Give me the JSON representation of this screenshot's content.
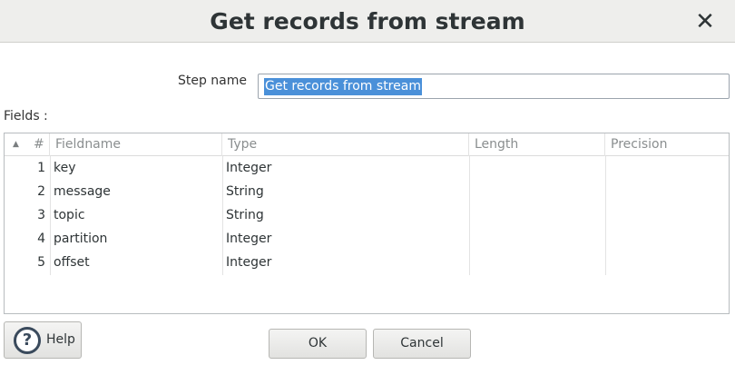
{
  "dialog": {
    "title": "Get records from stream",
    "close_label": "✕"
  },
  "step": {
    "label": "Step name",
    "value": "Get records from stream"
  },
  "fields": {
    "label": "Fields :",
    "columns": {
      "num": "#",
      "fieldname": "Fieldname",
      "type": "Type",
      "length": "Length",
      "precision": "Precision"
    },
    "rows": [
      {
        "num": "1",
        "fieldname": "key",
        "type": "Integer",
        "length": "",
        "precision": ""
      },
      {
        "num": "2",
        "fieldname": "message",
        "type": "String",
        "length": "",
        "precision": ""
      },
      {
        "num": "3",
        "fieldname": "topic",
        "type": "String",
        "length": "",
        "precision": ""
      },
      {
        "num": "4",
        "fieldname": "partition",
        "type": "Integer",
        "length": "",
        "precision": ""
      },
      {
        "num": "5",
        "fieldname": "offset",
        "type": "Integer",
        "length": "",
        "precision": ""
      }
    ]
  },
  "buttons": {
    "help": "Help",
    "help_icon": "?",
    "ok": "OK",
    "cancel": "Cancel"
  }
}
